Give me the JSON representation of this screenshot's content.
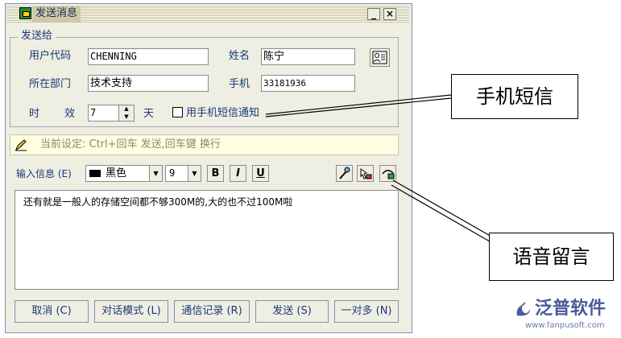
{
  "window": {
    "title": "发送消息",
    "minimize_label": "_",
    "close_label": "×"
  },
  "send_to": {
    "legend": "发送给",
    "user_code_label": "用户代码",
    "user_code_value": "CHENNING",
    "name_label": "姓名",
    "name_value": "陈宁",
    "dept_label": "所在部门",
    "dept_value": "技术支持",
    "mobile_label": "手机",
    "mobile_value": "33181936",
    "validity_label_1": "时",
    "validity_label_2": "效",
    "validity_value": "7",
    "validity_unit": "天",
    "sms_checkbox_label": "用手机短信通知",
    "sms_checked": false
  },
  "hint": {
    "text": "当前设定: Ctrl+回车 发送,回车键 换行"
  },
  "toolbar": {
    "input_label": "输入信息 (E)",
    "color_value": "黑色",
    "font_size_value": "9",
    "bold_label": "B",
    "italic_label": "I",
    "underline_label": "U"
  },
  "message": {
    "text": "还有就是一般人的存储空间都不够300M的,大的也不过100M啦"
  },
  "buttons": {
    "cancel": "取消 (C)",
    "dialog_mode": "对话模式 (L)",
    "history": "通信记录 (R)",
    "send": "发送 (S)",
    "one_to_many": "一对多 (N)"
  },
  "callouts": {
    "sms": "手机短信",
    "voice": "语音留言"
  },
  "logo": {
    "name": "泛普软件",
    "url": "www.fanpusoft.com"
  },
  "colors": {
    "window_bg": "#efeee2",
    "label_text": "#1a3a7a",
    "hint_bg": "#fefee3"
  }
}
